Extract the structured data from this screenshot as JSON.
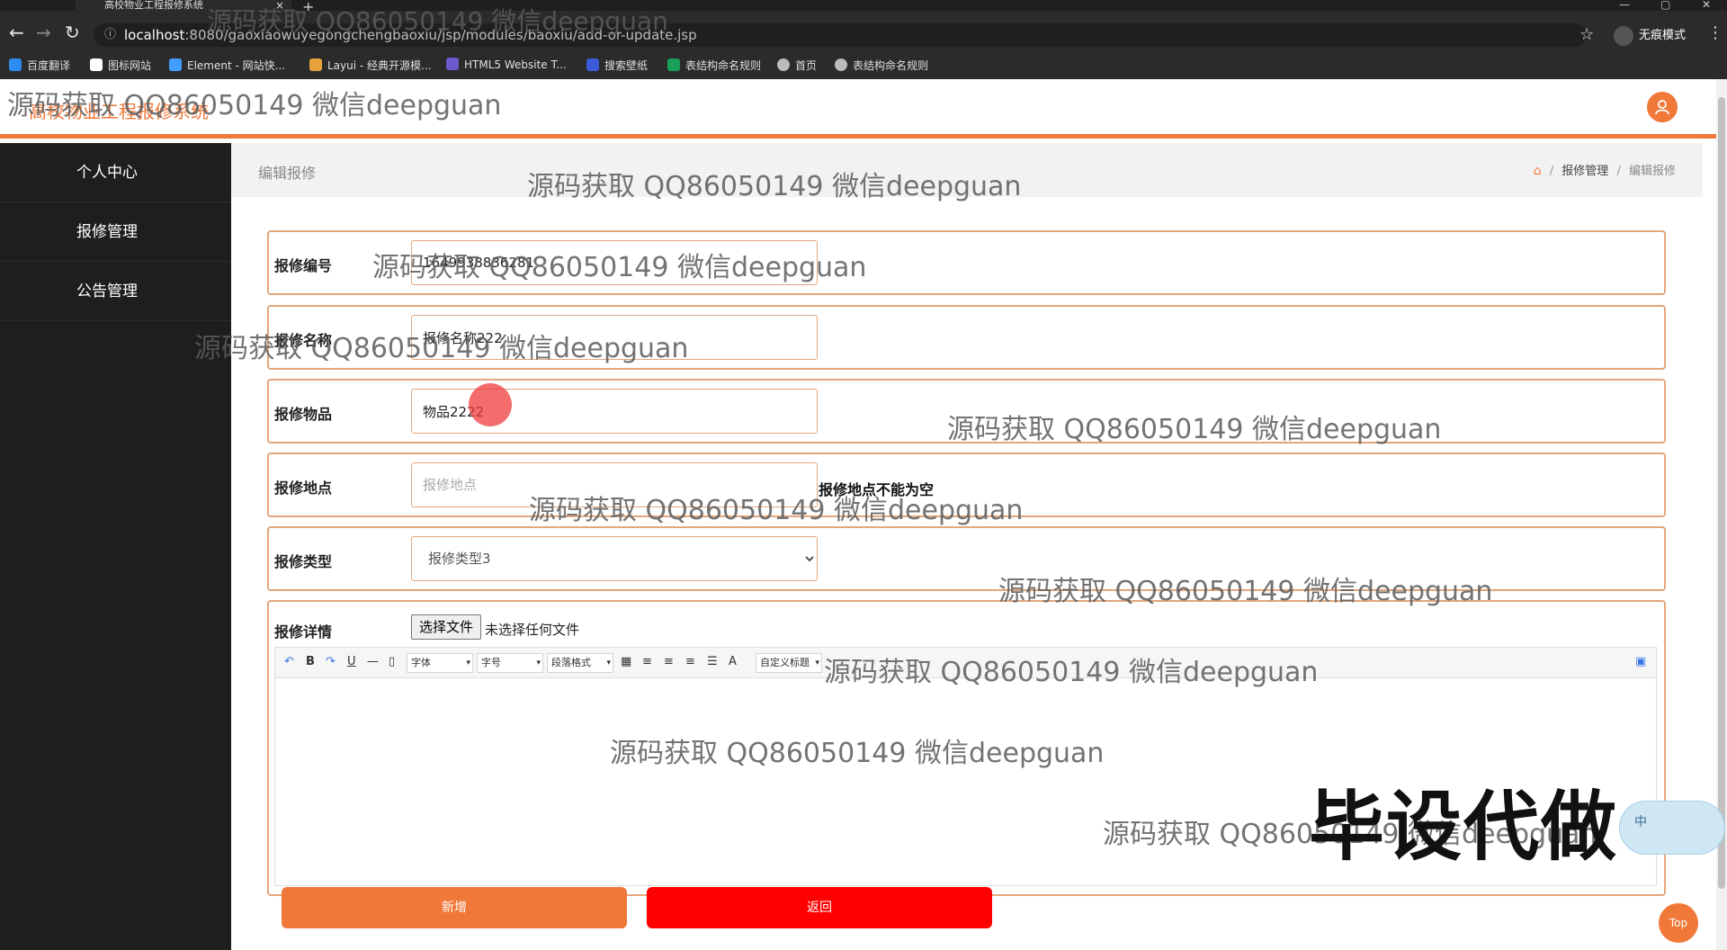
{
  "browser": {
    "tab_title": "高校物业工程报修系统",
    "tab_close": "×",
    "new_tab": "+",
    "url_host": "localhost",
    "url_rest": ":8080/gaoxiaowuyegongchengbaoxiu/jsp/modules/baoxiu/add-or-update.jsp",
    "profile_label": "无痕模式",
    "bookmarks": [
      {
        "label": "百度翻译",
        "color": "#2d8cf0"
      },
      {
        "label": "图标网站",
        "color": "#ffffff"
      },
      {
        "label": "Element - 网站快...",
        "color": "#409eff"
      },
      {
        "label": "Layui - 经典开源模...",
        "color": "#e6a23c"
      },
      {
        "label": "HTML5 Website T...",
        "color": "#6a5acd"
      },
      {
        "label": "搜索壁纸",
        "color": "#3b5bdb"
      },
      {
        "label": "表结构命名规则",
        "color": "#18a058"
      },
      {
        "label": "首页",
        "color": "#bbbbbb"
      },
      {
        "label": "表结构命名规则",
        "color": "#bbbbbb"
      }
    ]
  },
  "app": {
    "title": "高校物业工程报修系统",
    "accent": "#f0793a",
    "sidebar": [
      "个人中心",
      "报修管理",
      "公告管理"
    ],
    "breadcrumb": {
      "page_title": "编辑报修",
      "items": [
        "报修管理",
        "编辑报修"
      ],
      "separator": "/"
    },
    "form": {
      "fields": [
        {
          "label": "报修编号",
          "value": "1649938836281",
          "placeholder": ""
        },
        {
          "label": "报修名称",
          "value": "报修名称222",
          "placeholder": ""
        },
        {
          "label": "报修物品",
          "value": "物品2222",
          "placeholder": ""
        },
        {
          "label": "报修地点",
          "value": "",
          "placeholder": "报修地点",
          "error": "报修地点不能为空"
        }
      ],
      "type": {
        "label": "报修类型",
        "selected": "报修类型3"
      },
      "detail": {
        "label": "报修详情",
        "file_button": "选择文件",
        "file_status": "未选择任何文件",
        "toolbar": {
          "font": "字体",
          "size": "字号",
          "paragraph": "段落格式",
          "custom_title": "自定义标题",
          "bold": "B",
          "underline": "U",
          "color_a": "A"
        }
      },
      "buttons": {
        "submit": "新增",
        "back": "返回",
        "submit_color": "#f0793a",
        "back_color": "#ff0000"
      }
    },
    "top_button": "Top"
  },
  "overlay": {
    "watermark": "源码获取 QQ86050149 微信deepguan",
    "stamp": "毕设代做",
    "ime_label": "中"
  }
}
